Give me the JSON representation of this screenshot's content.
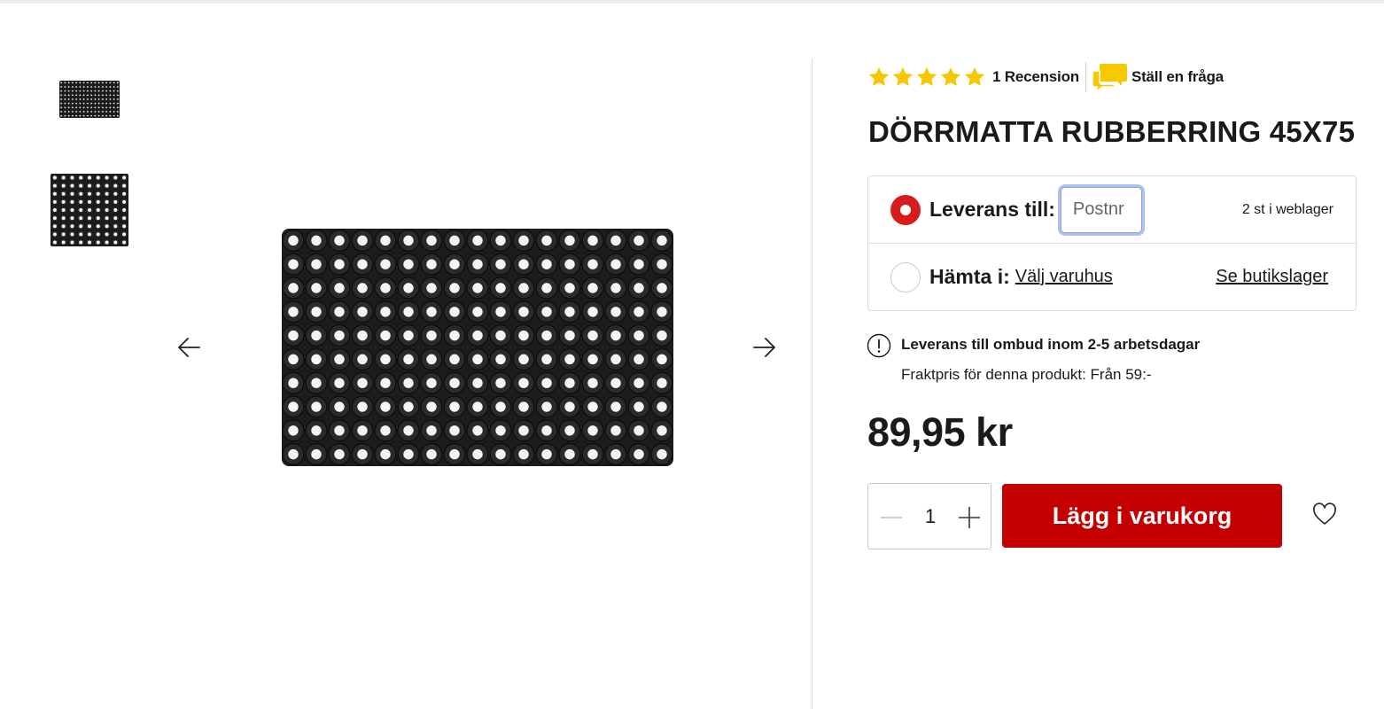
{
  "colors": {
    "brand_red": "#c40000",
    "radio_active": "#d71c1c",
    "star_yellow": "#f5c800",
    "border_gray": "#dcdcdc"
  },
  "gallery": {
    "thumbnails": [
      "doormat-thumbnail",
      "doormat-closeup-thumbnail"
    ],
    "prev_icon": "arrow-left-icon",
    "next_icon": "arrow-right-icon"
  },
  "rating": {
    "stars": 5,
    "max_stars": 5,
    "review_link": "1 Recension",
    "ask_icon": "chat-bubbles-icon",
    "ask_link": "Ställ en fråga"
  },
  "product": {
    "title": "DÖRRMATTA RUBBERRING 45X75",
    "price": "89,95 kr"
  },
  "delivery": {
    "option_delivery_label": "Leverans till:",
    "postnr_placeholder": "Postnr",
    "web_stock": "2 st i weblager",
    "option_pickup_label": "Hämta i:",
    "choose_store_link": "Välj varuhus",
    "store_stock_link": "Se butikslager",
    "selected_option": "delivery"
  },
  "shipping_info": {
    "icon": "info-exclamation-icon",
    "title": "Leverans till ombud inom 2-5 arbetsdagar",
    "subtitle": "Fraktpris för denna produkt: Från 59:-"
  },
  "cart": {
    "quantity": "1",
    "add_button": "Lägg i varukorg",
    "wishlist_icon": "heart-icon"
  }
}
